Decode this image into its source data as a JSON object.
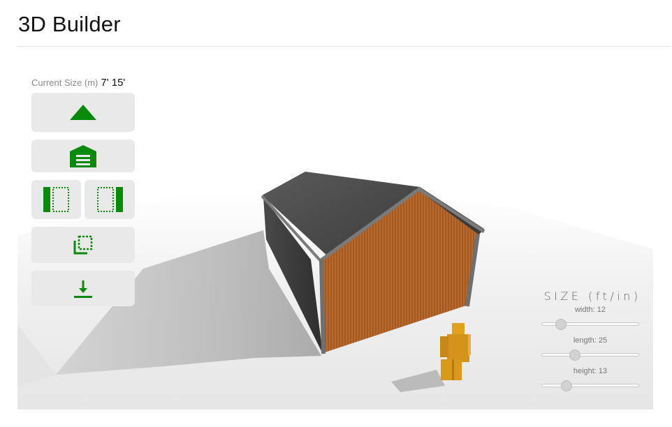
{
  "header": {
    "title": "3D Builder"
  },
  "current_size": {
    "label": "Current Size (m)",
    "value": "7' 15'"
  },
  "toolbar": {
    "buttons": [
      {
        "name": "roof-button",
        "icon": "roof-triangle-icon"
      },
      {
        "name": "garage-door-button",
        "icon": "garage-door-icon"
      },
      {
        "name": "left-wall-button",
        "icon": "left-wall-icon"
      },
      {
        "name": "right-wall-button",
        "icon": "right-wall-icon"
      },
      {
        "name": "copy-button",
        "icon": "copy-icon"
      },
      {
        "name": "download-button",
        "icon": "download-icon"
      }
    ],
    "accent_color": "#0a8a0a"
  },
  "size_panel": {
    "heading": "SIZE (ft/in)",
    "sliders": [
      {
        "label": "width: 12",
        "fraction": 0.16
      },
      {
        "label": "length: 25",
        "fraction": 0.32
      },
      {
        "label": "height: 13",
        "fraction": 0.22
      }
    ]
  },
  "scene": {
    "wall_color": "#b0652a",
    "roof_color": "#4a4a4a",
    "figure_color": "#e0a21a"
  }
}
